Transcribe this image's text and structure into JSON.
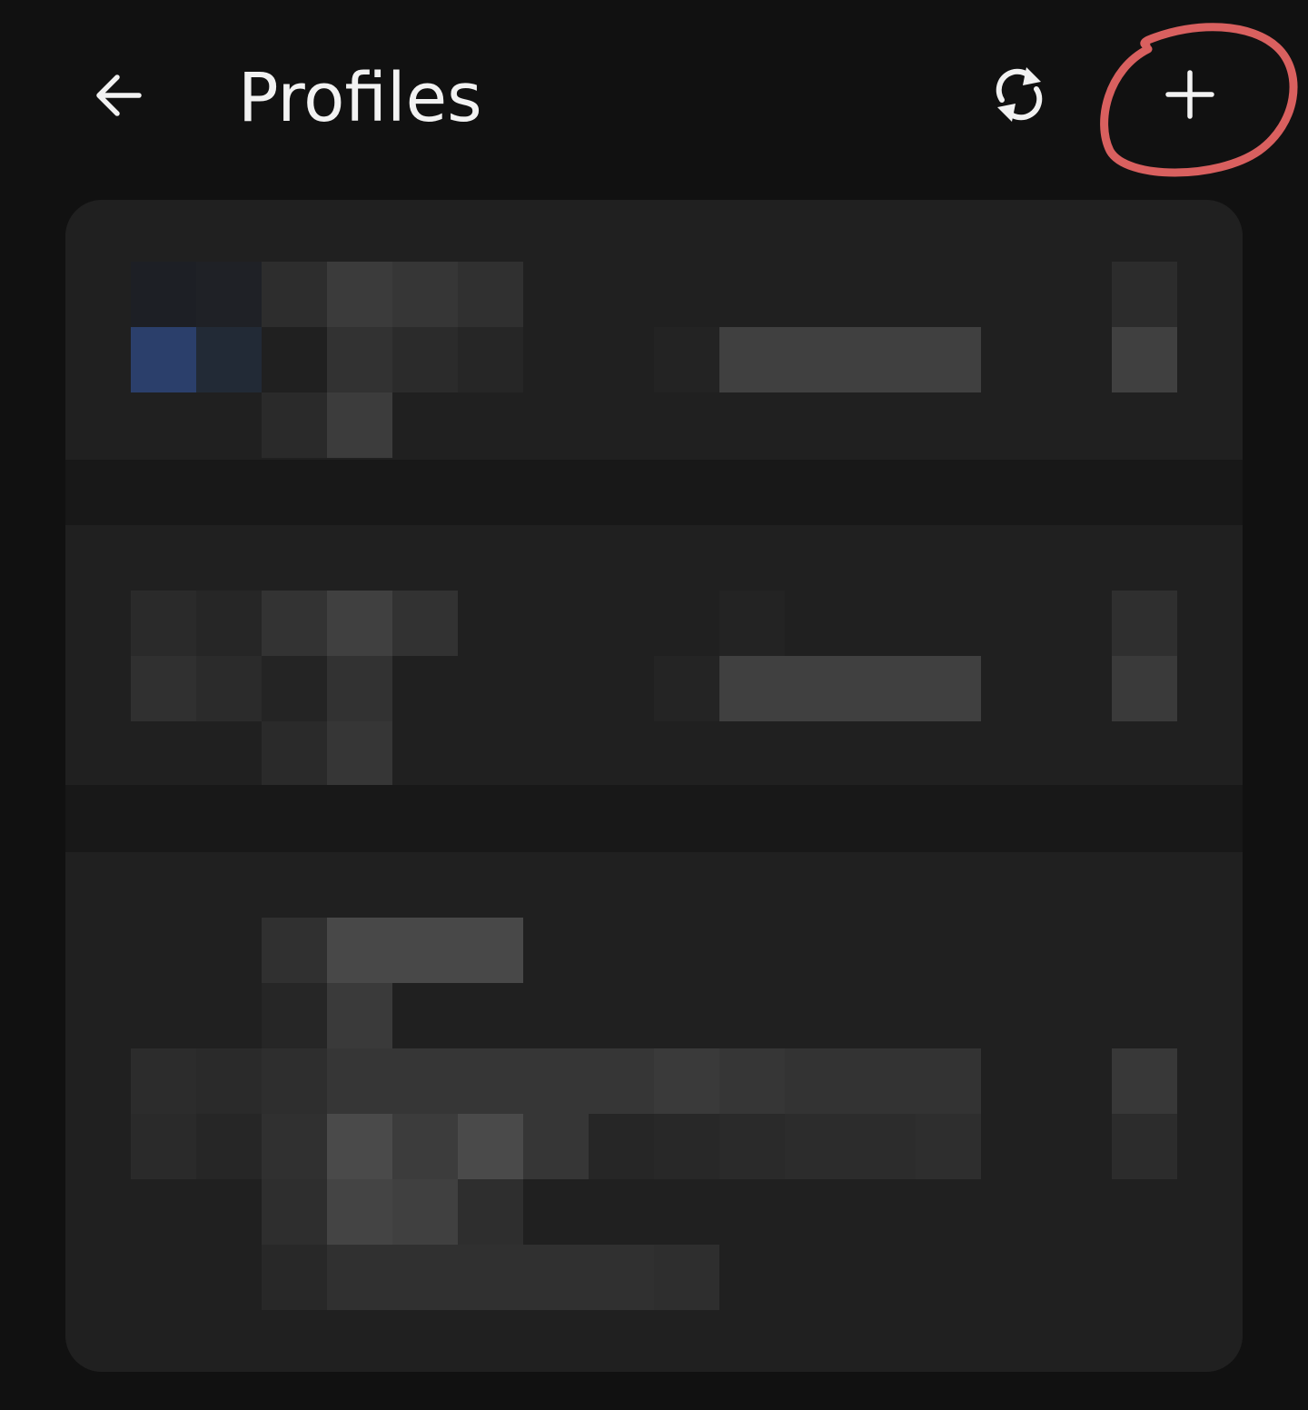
{
  "app_bar": {
    "title": "Profiles",
    "back_icon": "arrow-left-icon",
    "refresh_icon": "sync-icon",
    "add_icon": "plus-icon"
  },
  "annotation": {
    "type": "hand-drawn circle around add button",
    "color": "#d9605f"
  },
  "profiles": [
    {
      "redacted": true
    },
    {
      "redacted": true
    },
    {
      "redacted": true
    }
  ],
  "colors": {
    "background": "#111111",
    "card": "#202020",
    "text": "#f2f2f2",
    "accent_blue": "#2b3f6b"
  }
}
